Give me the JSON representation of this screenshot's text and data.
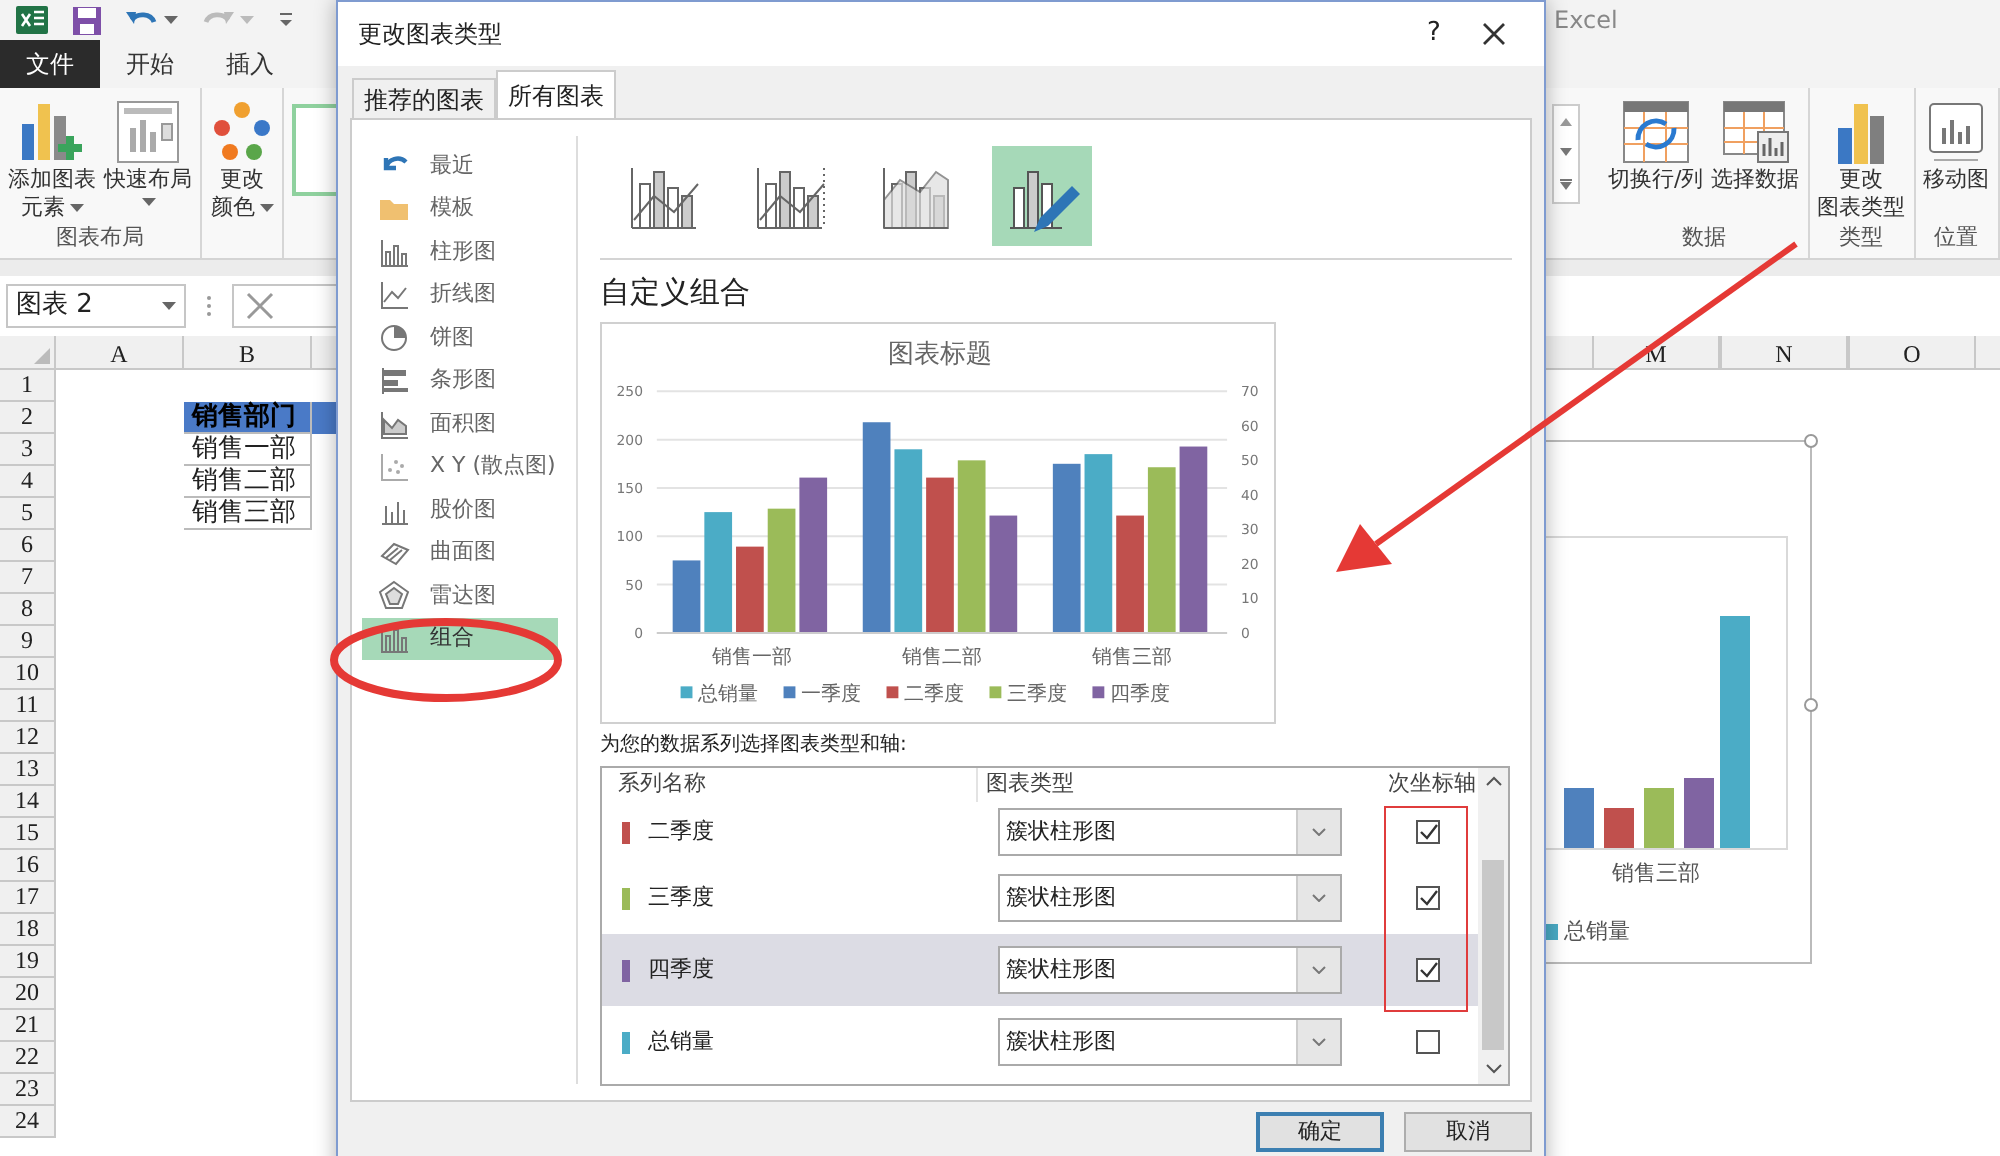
{
  "app_title": "Excel",
  "ribbon_tabs": [
    {
      "label": "文件",
      "kind": "file"
    },
    {
      "label": "开始",
      "kind": "tab"
    },
    {
      "label": "插入",
      "kind": "tab"
    }
  ],
  "ribbon_left": [
    {
      "label": "图表布局",
      "buttons": [
        {
          "lines": [
            "添加图表",
            "元素"
          ],
          "dropdown": true
        },
        {
          "lines": [
            "快速布局"
          ],
          "dropdown": true
        }
      ]
    },
    {
      "buttons": [
        {
          "lines": [
            "更改",
            "颜色"
          ],
          "dropdown": true
        }
      ]
    }
  ],
  "ribbon_right": [
    {
      "label": "数据",
      "buttons": [
        {
          "lines": [
            "切换行/列"
          ],
          "dropdown": false
        },
        {
          "lines": [
            "选择数据"
          ],
          "dropdown": false
        }
      ]
    },
    {
      "label": "类型",
      "buttons": [
        {
          "lines": [
            "更改",
            "图表类型"
          ],
          "dropdown": false
        }
      ]
    },
    {
      "label": "位置",
      "buttons": [
        {
          "lines": [
            "移动图"
          ],
          "dropdown": false
        }
      ]
    }
  ],
  "name_box": {
    "value": "图表 2"
  },
  "sheet": {
    "columns_left": [
      "A",
      "B"
    ],
    "columns_right": [
      "M",
      "N",
      "O"
    ],
    "row_numbers": [
      "1",
      "2",
      "3",
      "4",
      "5",
      "6",
      "7",
      "8",
      "9",
      "10",
      "11",
      "12",
      "13",
      "14",
      "15",
      "16",
      "17",
      "18",
      "19",
      "20",
      "21",
      "22",
      "23",
      "24"
    ],
    "data_block": [
      {
        "text": "销售部门",
        "header": true
      },
      {
        "text": "销售一部",
        "header": false
      },
      {
        "text": "销售二部",
        "header": false
      },
      {
        "text": "销售三部",
        "header": false
      }
    ]
  },
  "sheet_chart": {
    "category_label": "销售三部",
    "legend_label": "总销量"
  },
  "dialog": {
    "title": "更改图表类型",
    "help": "?",
    "tabs": [
      {
        "label": "推荐的图表",
        "selected": false
      },
      {
        "label": "所有图表",
        "selected": true
      }
    ],
    "chart_types": [
      {
        "label": "最近",
        "selected": false
      },
      {
        "label": "模板",
        "selected": false
      },
      {
        "label": "柱形图",
        "selected": false
      },
      {
        "label": "折线图",
        "selected": false
      },
      {
        "label": "饼图",
        "selected": false
      },
      {
        "label": "条形图",
        "selected": false
      },
      {
        "label": "面积图",
        "selected": false
      },
      {
        "label": "X Y (散点图)",
        "selected": false
      },
      {
        "label": "股价图",
        "selected": false
      },
      {
        "label": "曲面图",
        "selected": false
      },
      {
        "label": "雷达图",
        "selected": false
      },
      {
        "label": "组合",
        "selected": true
      }
    ],
    "subtypes": [
      {
        "selected": false
      },
      {
        "selected": false
      },
      {
        "selected": false
      },
      {
        "selected": true
      }
    ],
    "subtype_title": "自定义组合",
    "chart_data": {
      "type": "bar",
      "title": "图表标题",
      "categories": [
        "销售一部",
        "销售二部",
        "销售三部"
      ],
      "series": [
        {
          "name": "总销量",
          "color": "#4bacc6",
          "values": [
            125,
            190,
            185
          ]
        },
        {
          "name": "一季度",
          "color": "#4f81bd",
          "values": [
            75,
            218,
            175
          ]
        },
        {
          "name": "二季度",
          "color": "#c0504d",
          "axis": "y2",
          "values": [
            25,
            45,
            34
          ]
        },
        {
          "name": "三季度",
          "color": "#9bbb59",
          "axis": "y2",
          "values": [
            36,
            50,
            48
          ]
        },
        {
          "name": "四季度",
          "color": "#8064a2",
          "axis": "y2",
          "values": [
            45,
            34,
            54
          ]
        }
      ],
      "stacked": false,
      "grid": true,
      "legend": true,
      "ylim": [
        0,
        250
      ],
      "yticks": [
        0,
        50,
        100,
        150,
        200,
        250
      ],
      "y2lim": [
        0,
        70
      ],
      "y2ticks": [
        0,
        10,
        20,
        30,
        40,
        50,
        60,
        70
      ]
    },
    "series_prompt": "为您的数据系列选择图表类型和轴:",
    "series_table": {
      "columns": [
        "系列名称",
        "图表类型",
        "次坐标轴"
      ],
      "rows": [
        {
          "name": "二季度",
          "color": "#c0504d",
          "chart_type": "簇状柱形图",
          "secondary_axis": true,
          "selected": false
        },
        {
          "name": "三季度",
          "color": "#9bbb59",
          "chart_type": "簇状柱形图",
          "secondary_axis": true,
          "selected": false
        },
        {
          "name": "四季度",
          "color": "#8064a2",
          "chart_type": "簇状柱形图",
          "secondary_axis": true,
          "selected": true
        },
        {
          "name": "总销量",
          "color": "#4bacc6",
          "chart_type": "簇状柱形图",
          "secondary_axis": false,
          "selected": false
        }
      ]
    },
    "buttons": [
      {
        "label": "确定",
        "kind": "default"
      },
      {
        "label": "取消",
        "kind": "normal"
      }
    ]
  }
}
